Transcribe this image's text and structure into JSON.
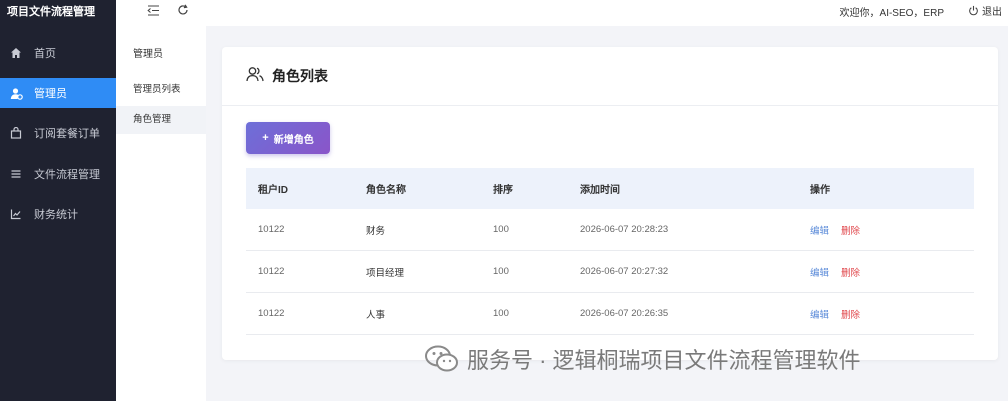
{
  "app": {
    "title": "项目文件流程管理"
  },
  "sidebar": {
    "items": [
      {
        "label": "首页",
        "icon": "home-icon"
      },
      {
        "label": "管理员",
        "icon": "admin-user-icon",
        "active": true
      },
      {
        "label": "订阅套餐订单",
        "icon": "bag-icon"
      },
      {
        "label": "文件流程管理",
        "icon": "list-icon"
      },
      {
        "label": "财务统计",
        "icon": "chart-icon"
      }
    ]
  },
  "subnav": {
    "title": "管理员",
    "items": [
      {
        "label": "管理员列表"
      },
      {
        "label": "角色管理",
        "active": true
      }
    ]
  },
  "topbar": {
    "welcome": "欢迎你，AI-SEO，ERP",
    "logout_label": "退出"
  },
  "card": {
    "title": "角色列表",
    "add_button_label": "新增角色"
  },
  "table": {
    "headers": [
      "租户ID",
      "角色名称",
      "排序",
      "添加时间",
      "操作"
    ],
    "rows": [
      {
        "tenant_id": "10122",
        "name": "财务",
        "sort": "100",
        "time": "2026-06-07 20:28:23"
      },
      {
        "tenant_id": "10122",
        "name": "项目经理",
        "sort": "100",
        "time": "2026-06-07 20:27:32"
      },
      {
        "tenant_id": "10122",
        "name": "人事",
        "sort": "100",
        "time": "2026-06-07 20:26:35"
      }
    ],
    "edit_label": "编辑",
    "delete_label": "删除"
  },
  "watermark": {
    "text": "服务号 · 逻辑桐瑞项目文件流程管理软件"
  },
  "colors": {
    "sidebar_bg": "#1f2230",
    "active_blue": "#2f8cf5",
    "button_gradient_start": "#6d6fd8",
    "button_gradient_end": "#8a55c9",
    "edit_link": "#5b8bd9",
    "delete_link": "#e0454a"
  }
}
